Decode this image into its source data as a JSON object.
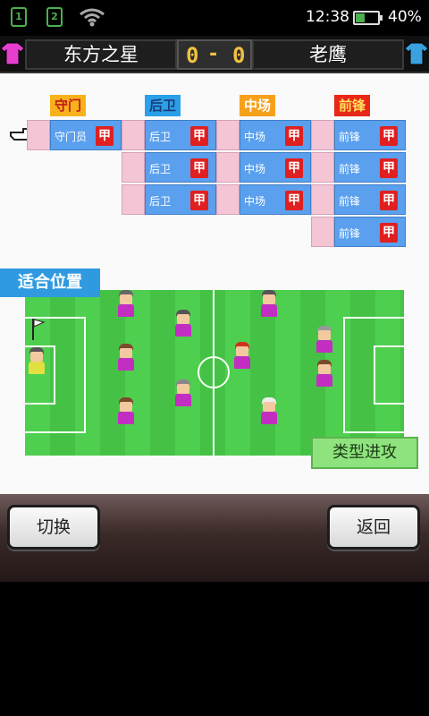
{
  "status_bar": {
    "sim1": "1",
    "sim2": "2",
    "icons": [
      "sim1-icon",
      "sim2-icon",
      "wifi-icon",
      "battery-icon"
    ],
    "time": "12:38",
    "battery_pct": "40%",
    "battery_level": 0.4
  },
  "scoreboard": {
    "home_team": "东方之星",
    "home_score": "0",
    "separator": "-",
    "away_score": "0",
    "away_team": "老鹰",
    "home_jersey_color": "#e83ed0",
    "away_jersey_color": "#3aa0e0"
  },
  "positions": {
    "goalkeeper": {
      "header": "守门员",
      "players": [
        {
          "role": "守门员",
          "grade": "甲"
        }
      ]
    },
    "defender": {
      "header": "后卫",
      "players": [
        {
          "role": "后卫",
          "grade": "甲"
        },
        {
          "role": "后卫",
          "grade": "甲"
        },
        {
          "role": "后卫",
          "grade": "甲"
        }
      ]
    },
    "midfielder": {
      "header": "中场",
      "players": [
        {
          "role": "中场",
          "grade": "甲"
        },
        {
          "role": "中场",
          "grade": "甲"
        },
        {
          "role": "中场",
          "grade": "甲"
        }
      ]
    },
    "forward": {
      "header": "前锋",
      "players": [
        {
          "role": "前锋",
          "grade": "甲"
        },
        {
          "role": "前锋",
          "grade": "甲"
        },
        {
          "role": "前锋",
          "grade": "甲"
        },
        {
          "role": "前锋",
          "grade": "甲"
        }
      ]
    }
  },
  "pitch": {
    "label": "适合位置",
    "tactic_button": "类型进攻"
  },
  "buttons": {
    "switch": "切换",
    "back": "返回"
  },
  "colors": {
    "accent_blue": "#2f9ae0",
    "grade_red": "#e02020",
    "pitch_green": "#4fcf4f",
    "player_shirt": "#c22ec2"
  }
}
